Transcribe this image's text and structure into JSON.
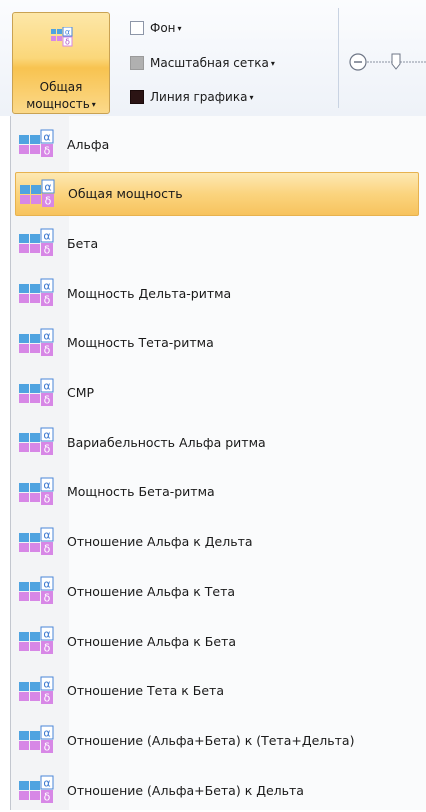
{
  "ribbon": {
    "big_button": {
      "line1": "Общая",
      "line2": "мощность",
      "icon": "alpha-delta-grid-icon"
    },
    "background_label": "Фон",
    "grid_label": "Масштабная сетка",
    "line_label": "Линия графика",
    "grid_color": "#b0b0b0",
    "line_color": "#2b1414"
  },
  "menu": {
    "selected_index": 1,
    "items": [
      "Альфа",
      "Общая мощность",
      "Бета",
      "Мощность Дельта-ритма",
      "Мощность Тета-ритма",
      "СМР",
      "Вариабельность Альфа ритма",
      "Мощность Бета-ритма",
      "Отношение Альфа к Дельта",
      "Отношение Альфа к Тета",
      "Отношение Альфа к Бета",
      "Отношение Тета к Бета",
      "Отношение (Альфа+Бета) к (Тета+Дельта)",
      "Отношение (Альфа+Бета) к Дельта"
    ]
  },
  "colors": {
    "icon_blue": "#4fa3e0",
    "icon_magenta": "#d787e6",
    "icon_symbol": "#4a86d8",
    "highlight": "#fbd47e"
  }
}
